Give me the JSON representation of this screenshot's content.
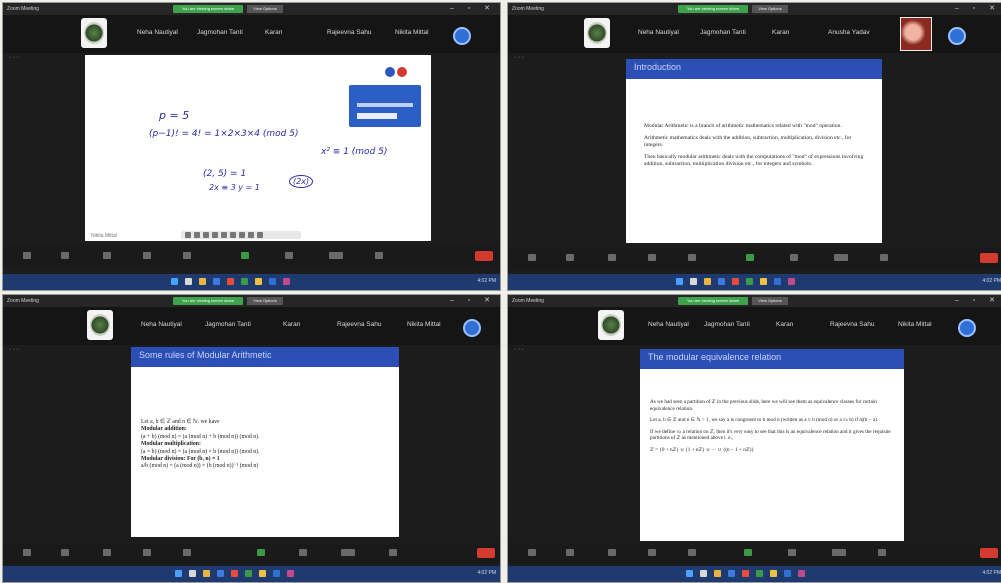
{
  "app_title": "Zoom Meeting",
  "share_label": "You are viewing screen share",
  "view_options": "View Options",
  "window_controls": "– ▫ ✕",
  "participants": [
    "Neha Nautiyal",
    "Jagmohan Tanti",
    "Karan",
    "Rajeevna Sahu",
    "Nikita Mittal"
  ],
  "participants_p2": [
    "Neha Nautiyal",
    "Jagmohan Tanti",
    "Karan",
    "Anusha Yadav"
  ],
  "p1": {
    "hand": {
      "line1": "p = 5",
      "line2": "(p−1)! = 4! = 1×2×3×4 (mod 5)",
      "line3": "x² ≡ 1 (mod 5)",
      "line4": "(2, 5) = 1",
      "line5": "2x ≡ 3 y = 1",
      "line6": "(2x)"
    },
    "chat_user": "Nikita Mittal"
  },
  "p2": {
    "title": "Introduction",
    "paras": [
      "Modular Arithmetic is a branch of arithmetic mathematics related with \"mod\" operation.",
      "Arithmetic mathematics deals with the addition, subtraction, multiplication, division etc., for integers.",
      "Then basically modular arithmetic deals with the computations of \"mod\" of expressions involving addition, subtraction, multiplication division etc., for integers and symbols."
    ]
  },
  "p3": {
    "title": "Some rules of Modular Arithmetic",
    "lines": [
      "Let a, b ∈ ℤ and n ∈ ℕ. we have",
      "Modular addition:",
      "(a + b) (mod n) = (a (mod n) + b (mod n)) (mod n).",
      "Modular multiplication:",
      "(a × b) (mod n) = (a (mod n) × b (mod n)) (mod n).",
      "Modular division: For (b, n) = 1",
      "a/b (mod n) = (a (mod n)) × (b (mod n))⁻¹ (mod n)"
    ]
  },
  "p4": {
    "title": "The modular equivalence relation",
    "paras": [
      "As we had seen a partition of ℤ in the previous slide, here we will see them as equivalence classes for certain equivalence relation.",
      "Let a, b ∈ ℤ and n ∈ ℕ > 1, we say a is congruent to b mod n (written as a ≡ b (mod n) or a ≡ₙ b) if n|(b − a).",
      "If we define ≡ₙ a relation on ℤ, then it's very easy to see that this is an equivalence relation and it gives the requisite partitions of ℤ as mentioned above i. e.,",
      "ℤ = {0 + nℤ} ∪ {1 + nℤ} ∪ ··· ∪ {(n − 1 + nℤ)}"
    ]
  },
  "tray_time": "4:02 PM"
}
